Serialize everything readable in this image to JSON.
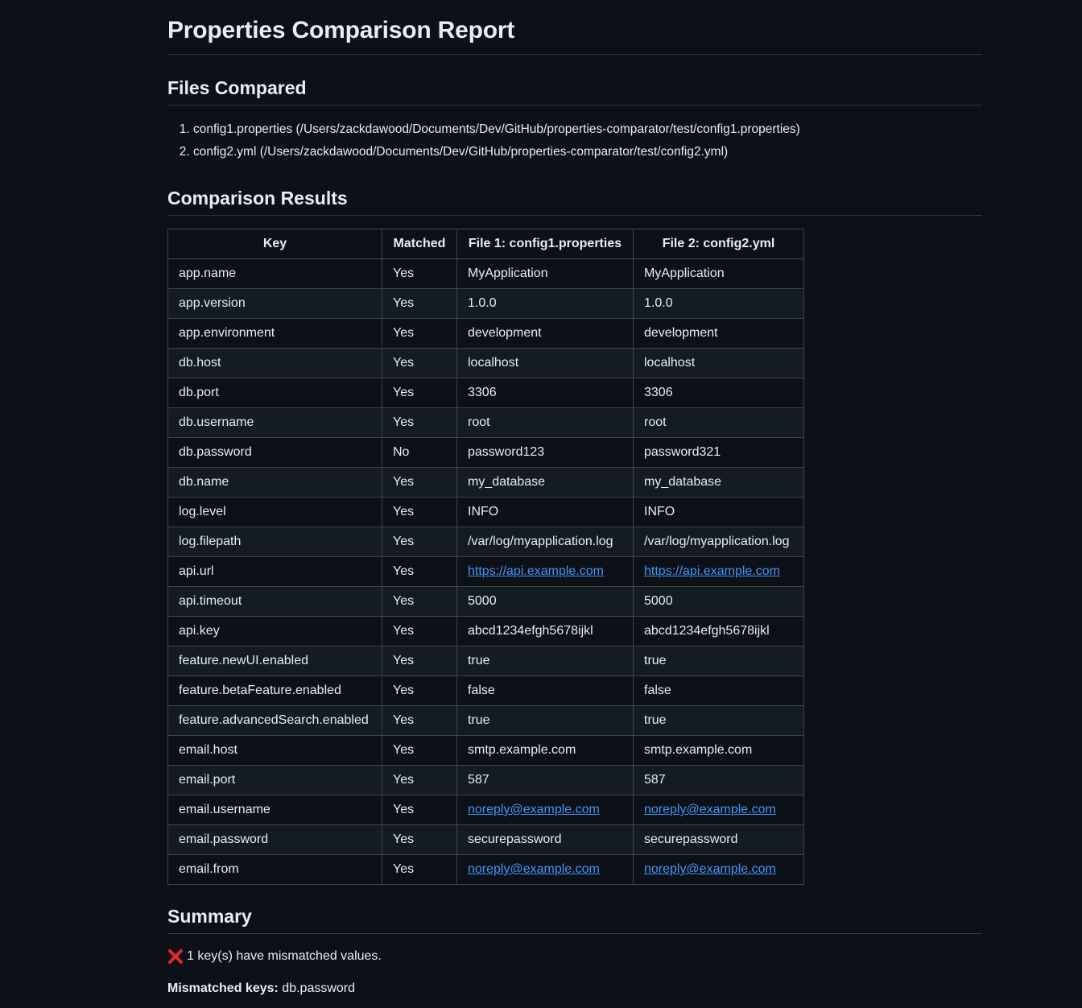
{
  "title": "Properties Comparison Report",
  "files_heading": "Files Compared",
  "files": [
    "config1.properties (/Users/zackdawood/Documents/Dev/GitHub/properties-comparator/test/config1.properties)",
    "config2.yml (/Users/zackdawood/Documents/Dev/GitHub/properties-comparator/test/config2.yml)"
  ],
  "results_heading": "Comparison Results",
  "table": {
    "headers": [
      "Key",
      "Matched",
      "File 1: config1.properties",
      "File 2: config2.yml"
    ],
    "rows": [
      {
        "key": "app.name",
        "matched": "Yes",
        "file1": "MyApplication",
        "file2": "MyApplication",
        "link": false
      },
      {
        "key": "app.version",
        "matched": "Yes",
        "file1": "1.0.0",
        "file2": "1.0.0",
        "link": false
      },
      {
        "key": "app.environment",
        "matched": "Yes",
        "file1": "development",
        "file2": "development",
        "link": false
      },
      {
        "key": "db.host",
        "matched": "Yes",
        "file1": "localhost",
        "file2": "localhost",
        "link": false
      },
      {
        "key": "db.port",
        "matched": "Yes",
        "file1": "3306",
        "file2": "3306",
        "link": false
      },
      {
        "key": "db.username",
        "matched": "Yes",
        "file1": "root",
        "file2": "root",
        "link": false
      },
      {
        "key": "db.password",
        "matched": "No",
        "file1": "password123",
        "file2": "password321",
        "link": false
      },
      {
        "key": "db.name",
        "matched": "Yes",
        "file1": "my_database",
        "file2": "my_database",
        "link": false
      },
      {
        "key": "log.level",
        "matched": "Yes",
        "file1": "INFO",
        "file2": "INFO",
        "link": false
      },
      {
        "key": "log.filepath",
        "matched": "Yes",
        "file1": "/var/log/myapplication.log",
        "file2": "/var/log/myapplication.log",
        "link": false
      },
      {
        "key": "api.url",
        "matched": "Yes",
        "file1": "https://api.example.com",
        "file2": "https://api.example.com",
        "link": true
      },
      {
        "key": "api.timeout",
        "matched": "Yes",
        "file1": "5000",
        "file2": "5000",
        "link": false
      },
      {
        "key": "api.key",
        "matched": "Yes",
        "file1": "abcd1234efgh5678ijkl",
        "file2": "abcd1234efgh5678ijkl",
        "link": false
      },
      {
        "key": "feature.newUI.enabled",
        "matched": "Yes",
        "file1": "true",
        "file2": "true",
        "link": false
      },
      {
        "key": "feature.betaFeature.enabled",
        "matched": "Yes",
        "file1": "false",
        "file2": "false",
        "link": false
      },
      {
        "key": "feature.advancedSearch.enabled",
        "matched": "Yes",
        "file1": "true",
        "file2": "true",
        "link": false
      },
      {
        "key": "email.host",
        "matched": "Yes",
        "file1": "smtp.example.com",
        "file2": "smtp.example.com",
        "link": false
      },
      {
        "key": "email.port",
        "matched": "Yes",
        "file1": "587",
        "file2": "587",
        "link": false
      },
      {
        "key": "email.username",
        "matched": "Yes",
        "file1": "noreply@example.com",
        "file2": "noreply@example.com",
        "link": true
      },
      {
        "key": "email.password",
        "matched": "Yes",
        "file1": "securepassword",
        "file2": "securepassword",
        "link": false
      },
      {
        "key": "email.from",
        "matched": "Yes",
        "file1": "noreply@example.com",
        "file2": "noreply@example.com",
        "link": true
      }
    ]
  },
  "summary_heading": "Summary",
  "summary": {
    "icon": "cross-mark-icon",
    "icon_color": "#e5262a",
    "message": "1 key(s) have mismatched values.",
    "mismatched_label": "Mismatched keys:",
    "mismatched_keys": "db.password"
  },
  "colors": {
    "background": "#0d1117",
    "text": "#e6edf3",
    "link": "#4493f8",
    "border": "#3d444d",
    "row_alt": "#151b23"
  }
}
